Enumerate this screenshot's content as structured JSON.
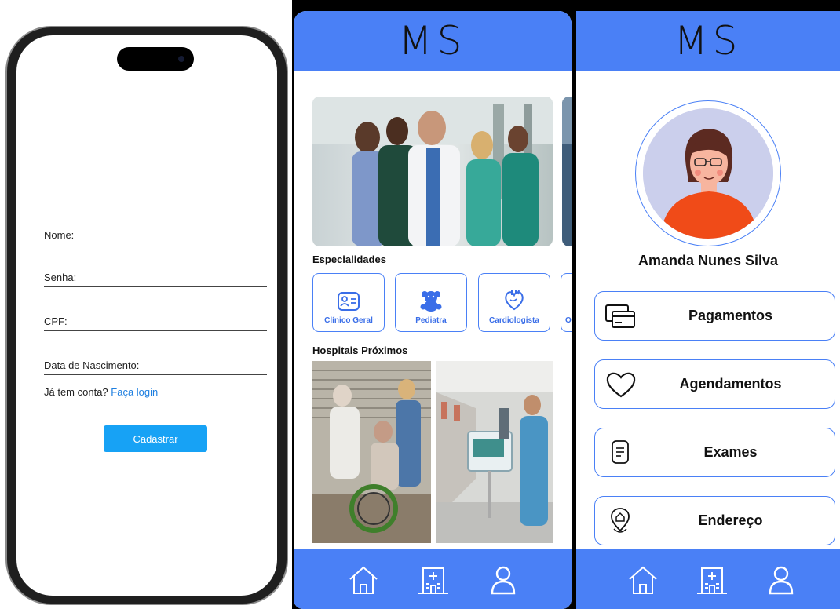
{
  "register": {
    "fields": [
      "Nome:",
      "Senha:",
      "CPF:",
      "Data de Nascimento:"
    ],
    "login_prompt": "Já tem conta?",
    "login_link": "Faça login",
    "submit_label": "Cadastrar"
  },
  "app": {
    "logo": "MS",
    "home": {
      "specialties_title": "Especialidades",
      "specialties": [
        "Clínico Geral",
        "Pediatra",
        "Cardiologista",
        "O"
      ],
      "hospitals_title": "Hospitais Próximos"
    },
    "profile": {
      "user_name": "Amanda Nunes Silva",
      "menu": [
        "Pagamentos",
        "Agendamentos",
        "Exames",
        "Endereço"
      ]
    },
    "nav_icons": [
      "home-icon",
      "hospital-icon",
      "user-icon"
    ],
    "colors": {
      "brand": "#4a80f6",
      "button": "#17a2f5",
      "link": "#1e7fe0"
    }
  }
}
